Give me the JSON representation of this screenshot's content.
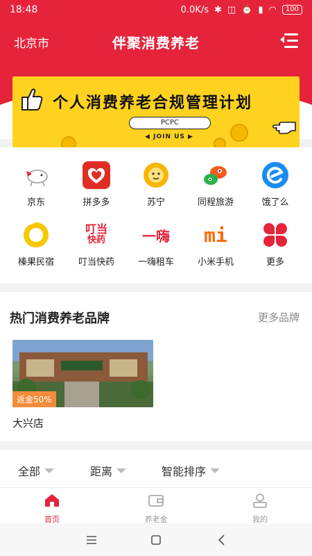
{
  "status_bar": {
    "time": "18:48",
    "speed": "0.0K/s",
    "battery": "100"
  },
  "header": {
    "city": "北京市",
    "title": "伴聚消费养老"
  },
  "banner": {
    "headline": "个人消费养老合规管理计划",
    "tag": "PCPC",
    "join": "JOIN US"
  },
  "apps": [
    {
      "label": "京东",
      "icon": "jd-dog-icon"
    },
    {
      "label": "拼多多",
      "icon": "pinduoduo-icon"
    },
    {
      "label": "苏宁",
      "icon": "suning-lion-icon"
    },
    {
      "label": "同程旅游",
      "icon": "tongcheng-icon"
    },
    {
      "label": "饿了么",
      "icon": "eleme-icon"
    },
    {
      "label": "榛果民宿",
      "icon": "hazelnut-icon"
    },
    {
      "label": "叮当快药",
      "icon": "dingdang-icon"
    },
    {
      "label": "一嗨租车",
      "icon": "yihai-icon"
    },
    {
      "label": "小米手机",
      "icon": "xiaomi-icon"
    },
    {
      "label": "更多",
      "icon": "more-clover-icon"
    }
  ],
  "app_icon_texts": {
    "dingdang_line1": "叮当",
    "dingdang_line2": "快药",
    "yihai": "一嗨",
    "xiaomi": "mi"
  },
  "hot_brands": {
    "title": "热门消费养老品牌",
    "more": "更多品牌",
    "stores": [
      {
        "name": "大兴店",
        "badge": "返金50%"
      }
    ]
  },
  "filters": [
    {
      "label": "全部"
    },
    {
      "label": "距离"
    },
    {
      "label": "智能排序"
    }
  ],
  "bottom_nav": [
    {
      "label": "首页",
      "active": true
    },
    {
      "label": "养老金",
      "active": false
    },
    {
      "label": "我的",
      "active": false
    }
  ],
  "colors": {
    "brand_red": "#e5243b",
    "banner_yellow": "#ffd21f",
    "badge_orange": "#f28c3a"
  }
}
